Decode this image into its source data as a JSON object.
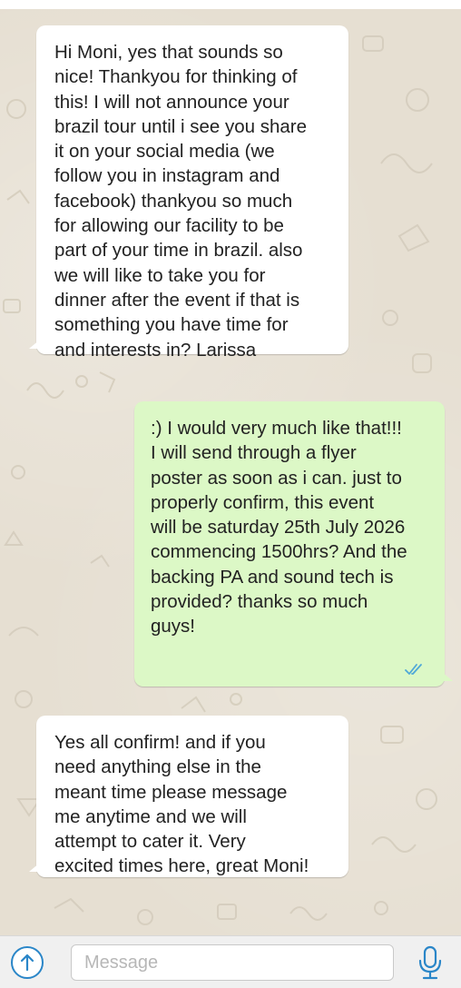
{
  "conversation": {
    "messages": [
      {
        "direction": "incoming",
        "text": "Hi Moni, yes that sounds so\nnice! Thankyou for thinking of\nthis! I will not announce your\nbrazil tour until i see you share\nit on your social media (we\nfollow you in instagram and\nfacebook) thankyou so much\nfor allowing our facility to be\npart of your time in brazil. also\nwe will like to take you for\ndinner after the event if that is\nsomething you have time for\nand interests in? Larissa"
      },
      {
        "direction": "outgoing",
        "text": ":) I would very much like that!!!\nI will send through a flyer\nposter as soon as i can. just to\nproperly confirm, this event\nwill be saturday 25th July 2026\ncommencing 1500hrs? And the\nbacking PA and sound tech is\nprovided? thanks so much\nguys!",
        "status_icon": "double-check-icon"
      },
      {
        "direction": "incoming",
        "text": "Yes all confirm! and if you\nneed anything else in the\nmeant time please message\nme anytime and we will\nattempt to cater it. Very\nexcited times here, great Moni!"
      }
    ]
  },
  "composer": {
    "placeholder": "Message",
    "upload_icon": "upload-arrow-icon",
    "mic_icon": "microphone-icon"
  },
  "colors": {
    "incoming_bubble": "#ffffff",
    "outgoing_bubble": "#dcf8c6",
    "read_ticks": "#4fa8d8",
    "accent": "#2a86c8",
    "chat_background": "#e6dfd2"
  }
}
